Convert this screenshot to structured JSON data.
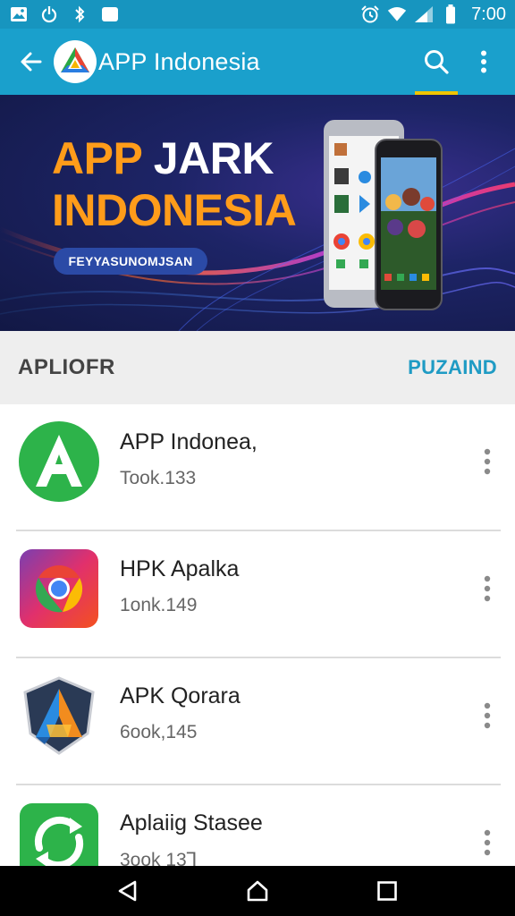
{
  "status_bar": {
    "time": "7:00",
    "left_icons": [
      "image-icon",
      "power-icon",
      "bluetooth-icon",
      "square-icon"
    ],
    "right_icons": [
      "alarm-icon",
      "wifi-icon",
      "signal-icon",
      "battery-icon"
    ]
  },
  "app_bar": {
    "title": "APP Indonesia",
    "back_icon": "arrow-left-icon",
    "search_icon": "search-icon",
    "more_icon": "more-vert-icon"
  },
  "banner": {
    "line1_accent": "APP",
    "line1_rest": " JARK",
    "line2": "INDONESIA",
    "pill_label": "FEYYASUNOMJSAN"
  },
  "section": {
    "title": "APLIOFR",
    "action": "PUZAIND"
  },
  "apps": [
    {
      "name": "APP Indonea,",
      "meta": "Took.133",
      "icon": "green-a-app-icon"
    },
    {
      "name": "HPK Apalka",
      "meta": "1onk.149",
      "icon": "chrome-style-app-icon"
    },
    {
      "name": "APK Qorara",
      "meta": "6ook,145",
      "icon": "shield-a-app-icon"
    },
    {
      "name": "Aplaiig Stasee",
      "meta": "3ook 13Ꞁ",
      "icon": "green-refresh-app-icon"
    }
  ],
  "nav_bar": {
    "back": "nav-back-icon",
    "home": "nav-home-icon",
    "recents": "nav-recents-icon"
  },
  "colors": {
    "primary": "#1aa0cc",
    "status": "#1795bf",
    "accent": "#f0c400",
    "banner_orange": "#ff9c1a",
    "section_action": "#1f9bc4"
  }
}
